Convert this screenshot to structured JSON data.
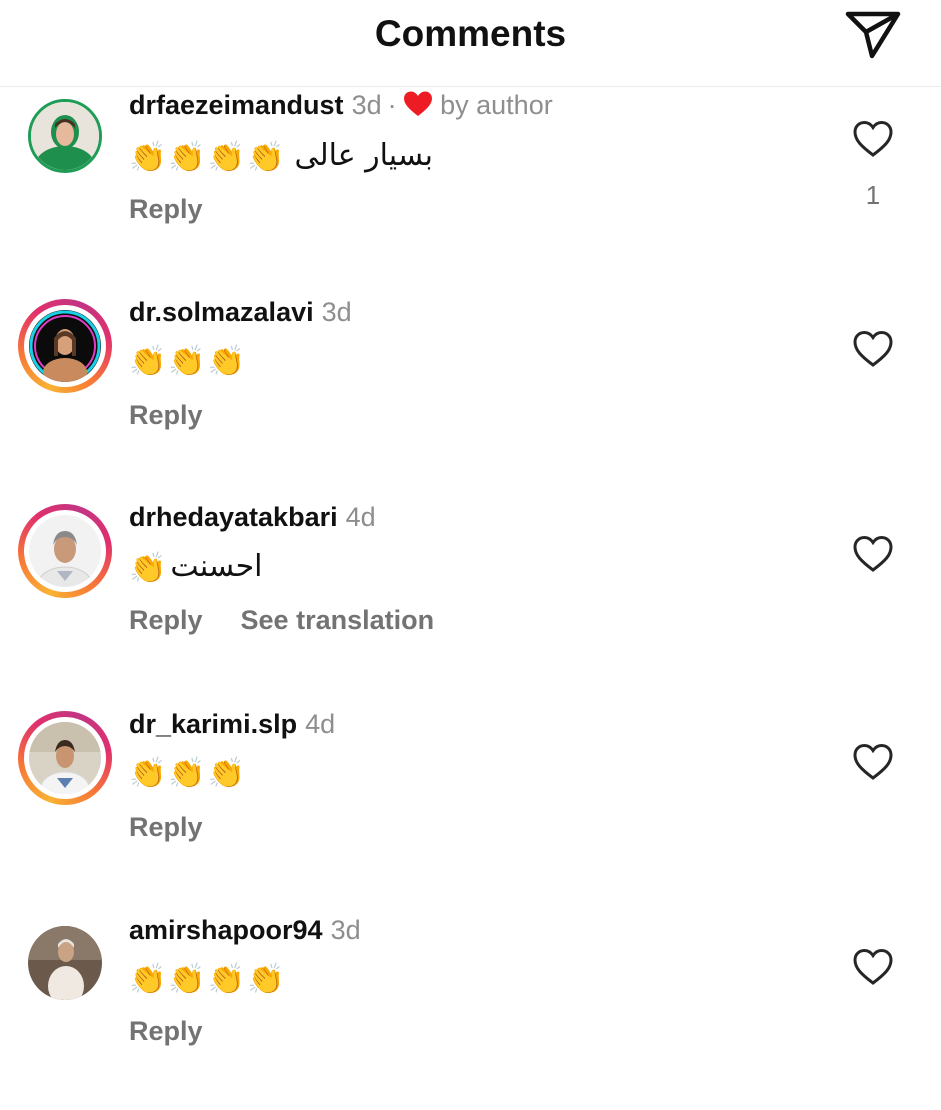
{
  "header": {
    "title": "Comments",
    "send_icon": "paper-plane-icon"
  },
  "comments": [
    {
      "username": "drfaezeimandust",
      "time": "3d",
      "separator": "·",
      "author_liked": true,
      "author_like_label": "by author",
      "claps": [
        "👏",
        "👏",
        "👏",
        "👏"
      ],
      "text": "بسیار عالی",
      "reply_label": "Reply",
      "like_count": "1",
      "story_ring": false
    },
    {
      "username": "dr.solmazalavi",
      "time": "3d",
      "claps": [
        "👏",
        "👏",
        "👏"
      ],
      "text": "",
      "reply_label": "Reply",
      "story_ring": true
    },
    {
      "username": "drhedayatakbari",
      "time": "4d",
      "claps": [
        "👏"
      ],
      "text": "احسنت",
      "reply_label": "Reply",
      "translation_label": "See translation",
      "story_ring": true
    },
    {
      "username": "dr_karimi.slp",
      "time": "4d",
      "claps": [
        "👏",
        "👏",
        "👏"
      ],
      "text": "",
      "reply_label": "Reply",
      "story_ring": true
    },
    {
      "username": "amirshapoor94",
      "time": "3d",
      "claps": [
        "👏",
        "👏",
        "👏",
        "👏"
      ],
      "text": "",
      "reply_label": "Reply",
      "story_ring": false
    }
  ],
  "colors": {
    "accent_heart": "#ed1c24",
    "muted_text": "#8e8e8e",
    "action_text": "#737373"
  }
}
